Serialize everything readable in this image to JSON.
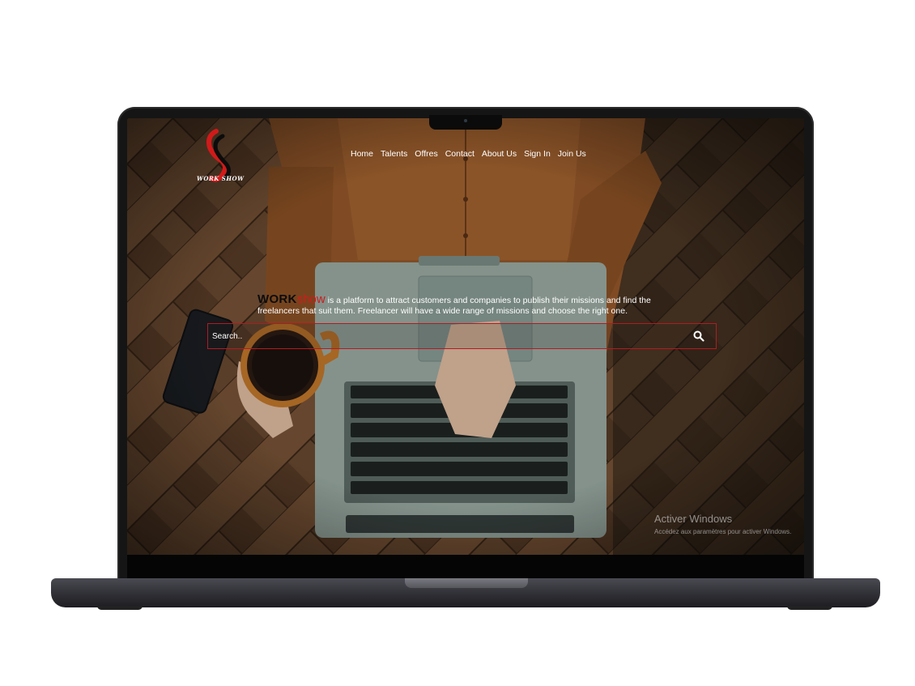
{
  "site": {
    "logo_text": "WORK SHOW",
    "nav": [
      "Home",
      "Talents",
      "Offres",
      "Contact",
      "About Us",
      "Sign In",
      "Join Us"
    ],
    "hero": {
      "brand_work": "WORK",
      "brand_show": "show",
      "description": "is a platform to attract customers and companies to publish their missions and find the freelancers that suit them. Freelancer will have a wide range of missions and choose the right one."
    },
    "search": {
      "placeholder": "Search..",
      "value": ""
    }
  },
  "os_watermark": {
    "title": "Activer Windows",
    "subtitle": "Accédez aux paramètres pour activer Windows."
  },
  "colors": {
    "accent_red": "#d11a1a",
    "search_border": "#b01c22",
    "laptop_body": "#2d2d33"
  },
  "icons": [
    "search-icon",
    "work-show-logo"
  ]
}
